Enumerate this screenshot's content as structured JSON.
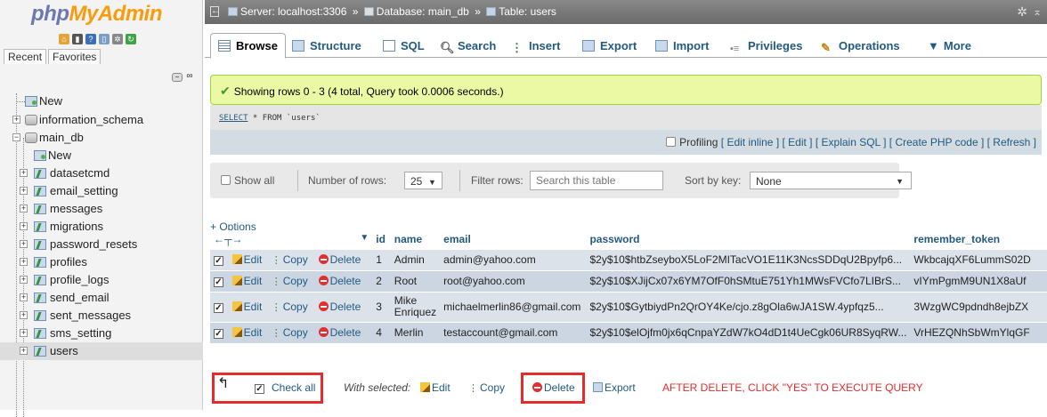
{
  "logo": {
    "php": "php",
    "myadmin": "MyAdmin"
  },
  "nav": {
    "tabs": [
      "Recent",
      "Favorites"
    ],
    "tree": [
      {
        "label": "New",
        "level": 0,
        "type": "new"
      },
      {
        "label": "information_schema",
        "level": 0,
        "type": "db"
      },
      {
        "label": "main_db",
        "level": 0,
        "type": "db"
      },
      {
        "label": "New",
        "level": 1,
        "type": "new"
      },
      {
        "label": "datasetcmd",
        "level": 1,
        "type": "table"
      },
      {
        "label": "email_setting",
        "level": 1,
        "type": "table"
      },
      {
        "label": "messages",
        "level": 1,
        "type": "table"
      },
      {
        "label": "migrations",
        "level": 1,
        "type": "table"
      },
      {
        "label": "password_resets",
        "level": 1,
        "type": "table"
      },
      {
        "label": "profiles",
        "level": 1,
        "type": "table"
      },
      {
        "label": "profile_logs",
        "level": 1,
        "type": "table"
      },
      {
        "label": "send_email",
        "level": 1,
        "type": "table"
      },
      {
        "label": "sent_messages",
        "level": 1,
        "type": "table"
      },
      {
        "label": "sms_setting",
        "level": 1,
        "type": "table"
      },
      {
        "label": "users",
        "level": 1,
        "type": "table",
        "selected": true
      }
    ]
  },
  "breadcrumb": {
    "server": "Server: localhost:3306",
    "sep": "»",
    "database": "Database: main_db",
    "table": "Table: users"
  },
  "tabs": {
    "browse": "Browse",
    "structure": "Structure",
    "sql": "SQL",
    "search": "Search",
    "insert": "Insert",
    "export": "Export",
    "import": "Import",
    "privileges": "Privileges",
    "operations": "Operations",
    "more": "More"
  },
  "result": {
    "message": "Showing rows 0 - 3 (4 total, Query took 0.0006 seconds.)",
    "sql_select": "SELECT",
    "sql_rest": " * FROM `users`"
  },
  "profiling": {
    "label": "Profiling",
    "links": [
      "[ Edit inline ]",
      "[ Edit ]",
      "[ Explain SQL ]",
      "[ Create PHP code ]",
      "[ Refresh ]"
    ]
  },
  "nav_controls": {
    "show_all": "Show all",
    "rows_label": "Number of rows:",
    "rows_value": "25",
    "filter_label": "Filter rows:",
    "filter_placeholder": "Search this table",
    "sort_label": "Sort by key:",
    "sort_value": "None"
  },
  "options_link": "+ Options",
  "table": {
    "headers": {
      "id": "id",
      "name": "name",
      "email": "email",
      "password": "password",
      "remember_token": "remember_token"
    },
    "edit": "Edit",
    "copy": "Copy",
    "delete": "Delete",
    "rows": [
      {
        "id": "1",
        "name": "Admin",
        "email": "admin@yahoo.com",
        "password": "$2y$10$htbZseyboX5LoF2MITacVO1E11K3NcsSDDqU2Bpyfp6...",
        "remember_token": "WkbcajqXF6LummS02D"
      },
      {
        "id": "2",
        "name": "Root",
        "email": "root@yahoo.com",
        "password": "$2y$10$XJijCx07x6YM7OfF0hSMtuE751Yh1MWsFVCfo7LIBrS...",
        "remember_token": "vIYmPgmM9UN1X8aUf"
      },
      {
        "id": "3",
        "name": "Mike Enriquez",
        "email": "michaelmerlin86@gmail.com",
        "password": "$2y$10$GytbiydPn2QrOY4Ke/cjo.z8gOla6wJA1SW.4ypfqz5...",
        "remember_token": "3WzgWC9pdndh8ejbZX"
      },
      {
        "id": "4",
        "name": "Merlin",
        "email": "testaccount@gmail.com",
        "password": "$2y$10$elOjfm0jx6qCnpaYZdW7kO4dD1t4UeCgk06UR8SyqRW...",
        "remember_token": "VrHEZQNhSbWmYlqGF"
      }
    ]
  },
  "bottom": {
    "check_all": "Check all",
    "with_selected": "With selected:",
    "edit": "Edit",
    "copy": "Copy",
    "delete": "Delete",
    "export": "Export",
    "note": "AFTER DELETE, CLICK \"YES\" TO EXECUTE QUERY"
  },
  "colors": {
    "accent": "#235a81",
    "annotation_red": "#e32c2c",
    "success_bg": "#ebf8a4"
  }
}
